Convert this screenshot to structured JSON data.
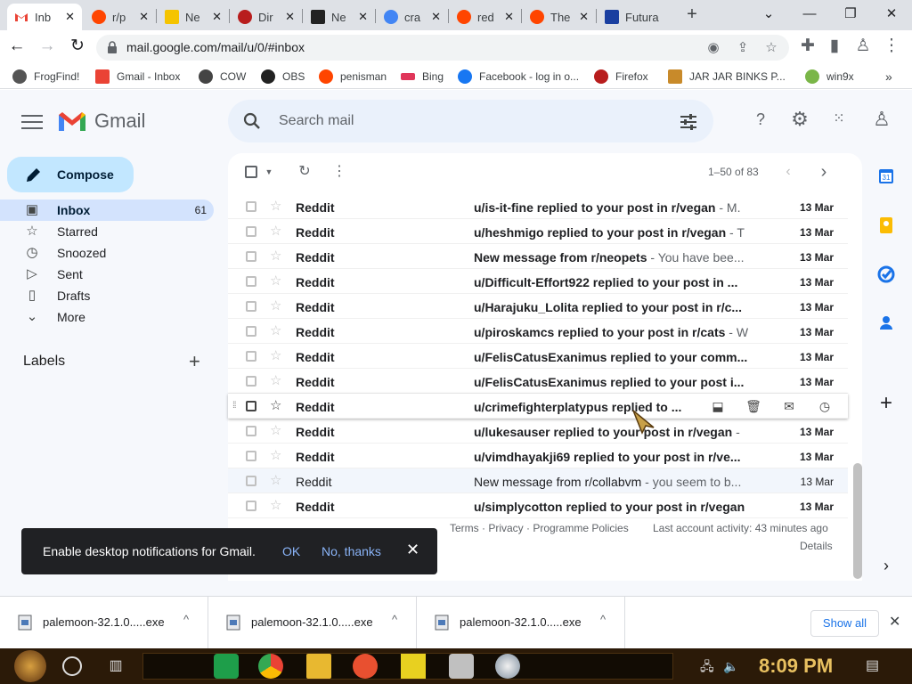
{
  "browser": {
    "tabs": [
      {
        "label": "Inb",
        "color": "#ea4335",
        "active": true
      },
      {
        "label": "r/p",
        "color": "#ff4500"
      },
      {
        "label": "Ne",
        "color": "#f5c400"
      },
      {
        "label": "Dir",
        "color": "#b81d1d"
      },
      {
        "label": "Ne",
        "color": "#222222"
      },
      {
        "label": "cra",
        "color": "#4285f4"
      },
      {
        "label": "red",
        "color": "#ff4500"
      },
      {
        "label": "The",
        "color": "#ff4500"
      },
      {
        "label": "Futura",
        "color": "#1a3fa0"
      }
    ],
    "close_glyph": "✕",
    "new_tab_glyph": "+",
    "url": "mail.google.com/mail/u/0/#inbox",
    "bookmarks": [
      {
        "label": "FrogFind!",
        "color": "#555555"
      },
      {
        "label": "Gmail - Inbox",
        "color": "#ea4335"
      },
      {
        "label": "COW",
        "color": "#444444"
      },
      {
        "label": "OBS",
        "color": "#222222"
      },
      {
        "label": "penisman",
        "color": "#ff4500"
      },
      {
        "label": "Bing",
        "color": "#e0365a"
      },
      {
        "label": "Facebook - log in o...",
        "color": "#1877f2"
      },
      {
        "label": "Firefox",
        "color": "#b81d1d"
      },
      {
        "label": "JAR JAR BINKS P...",
        "color": "#c88a2a"
      },
      {
        "label": "win9x",
        "color": "#7ab648"
      }
    ],
    "more_bookmarks_glyph": "»"
  },
  "gmail": {
    "logo_text": "Gmail",
    "search_placeholder": "Search mail",
    "compose_label": "Compose",
    "nav": [
      {
        "label": "Inbox",
        "count": "61",
        "icon": "inbox-icon",
        "selected": true
      },
      {
        "label": "Starred",
        "count": "",
        "icon": "star-icon"
      },
      {
        "label": "Snoozed",
        "count": "",
        "icon": "clock-icon"
      },
      {
        "label": "Sent",
        "count": "",
        "icon": "send-icon"
      },
      {
        "label": "Drafts",
        "count": "",
        "icon": "draft-icon"
      },
      {
        "label": "More",
        "count": "",
        "icon": "chevron-down-icon"
      }
    ],
    "labels_heading": "Labels",
    "pager_text": "1–50 of 83",
    "emails": [
      {
        "sender": "Reddit",
        "subject": "u/is-it-fine replied to your post in r/vegan",
        "snippet": " - M.",
        "date": "13 Mar",
        "unread": true
      },
      {
        "sender": "Reddit",
        "subject": "u/heshmigo replied to your post in r/vegan",
        "snippet": " - T",
        "date": "13 Mar",
        "unread": true
      },
      {
        "sender": "Reddit",
        "subject": "New message from r/neopets",
        "snippet": " - You have bee...",
        "date": "13 Mar",
        "unread": true
      },
      {
        "sender": "Reddit",
        "subject": "u/Difficult-Effort922 replied to your post in ...",
        "snippet": "",
        "date": "13 Mar",
        "unread": true
      },
      {
        "sender": "Reddit",
        "subject": "u/Harajuku_Lolita replied to your post in r/c...",
        "snippet": "",
        "date": "13 Mar",
        "unread": true
      },
      {
        "sender": "Reddit",
        "subject": "u/piroskamcs replied to your post in r/cats",
        "snippet": " - W",
        "date": "13 Mar",
        "unread": true
      },
      {
        "sender": "Reddit",
        "subject": "u/FelisCatusExanimus replied to your comm...",
        "snippet": "",
        "date": "13 Mar",
        "unread": true
      },
      {
        "sender": "Reddit",
        "subject": "u/FelisCatusExanimus replied to your post i...",
        "snippet": "",
        "date": "13 Mar",
        "unread": true
      },
      {
        "sender": "Reddit",
        "subject": "u/crimefighterplatypus replied to ...",
        "snippet": "",
        "date": "",
        "unread": true,
        "hover": true
      },
      {
        "sender": "Reddit",
        "subject": "u/lukesauser replied to your post in r/vegan",
        "snippet": " -",
        "date": "13 Mar",
        "unread": true
      },
      {
        "sender": "Reddit",
        "subject": "u/vimdhayakji69 replied to your post in r/ve...",
        "snippet": "",
        "date": "13 Mar",
        "unread": true
      },
      {
        "sender": "Reddit",
        "subject": "New message from r/collabvm",
        "snippet": " - you seem to b...",
        "date": "13 Mar",
        "unread": false
      },
      {
        "sender": "Reddit",
        "subject": "u/simplycotton replied to your post in r/vegan",
        "snippet": "",
        "date": "13 Mar",
        "unread": true
      }
    ],
    "footer": {
      "policies": "Terms · Privacy · Programme Policies",
      "activity": "Last account activity: 43 minutes ago",
      "details": "Details"
    },
    "toast": {
      "text": "Enable desktop notifications for Gmail.",
      "ok": "OK",
      "no": "No, thanks",
      "close": "✕"
    }
  },
  "downloads": {
    "items": [
      "palemoon-32.1.0.....exe",
      "palemoon-32.1.0.....exe",
      "palemoon-32.1.0.....exe"
    ],
    "chevron": "^",
    "show_all": "Show all",
    "close": "✕"
  },
  "taskbar": {
    "time": "8:09 PM"
  }
}
